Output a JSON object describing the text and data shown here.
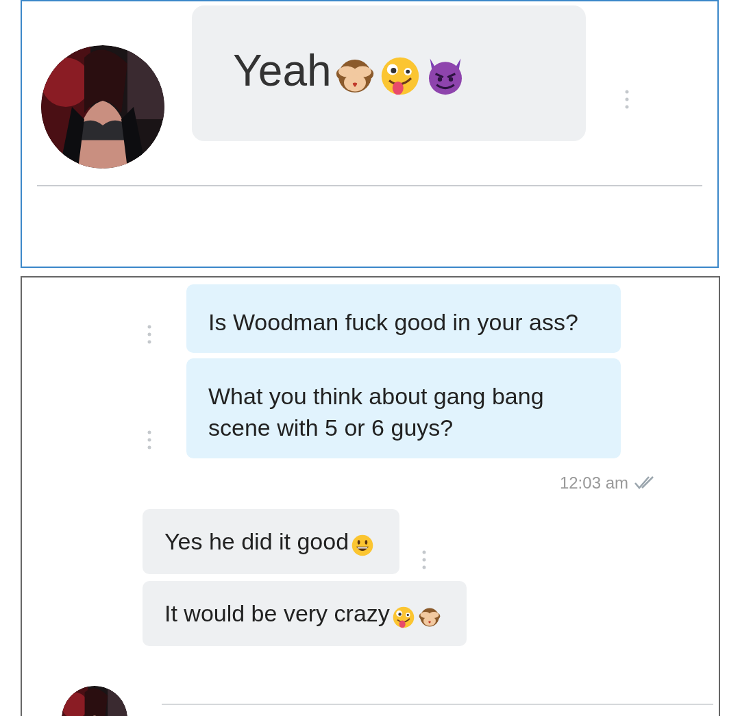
{
  "top_panel": {
    "message": {
      "text": "Yeah",
      "emojis": [
        {
          "kind": "monkey"
        },
        {
          "kind": "zany"
        },
        {
          "kind": "devil"
        }
      ]
    }
  },
  "bottom_panel": {
    "sent": [
      {
        "text": "Is Woodman fuck good in your ass?"
      },
      {
        "text": "What you think about gang bang scene with 5 or 6 guys?"
      }
    ],
    "timestamp": "12:03 am",
    "read": true,
    "received": [
      {
        "text": "Yes he did it good",
        "emojis": [
          {
            "kind": "grin"
          }
        ]
      },
      {
        "text": "It would be very crazy",
        "emojis": [
          {
            "kind": "zany"
          },
          {
            "kind": "monkey"
          }
        ]
      }
    ]
  }
}
